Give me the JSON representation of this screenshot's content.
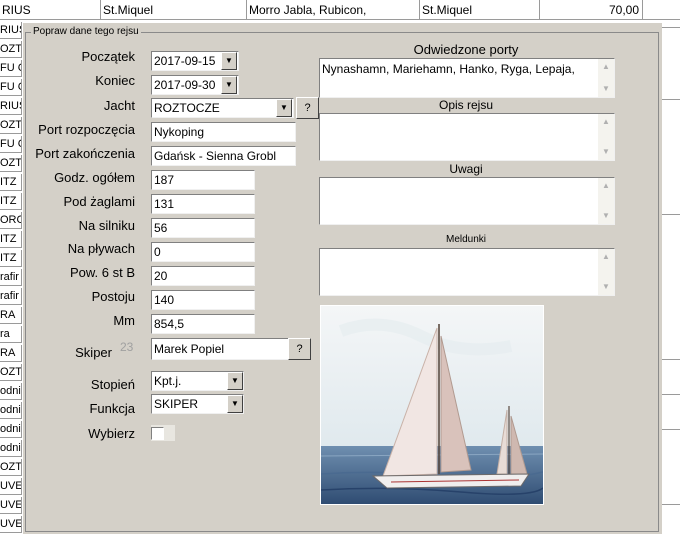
{
  "grid": {
    "top_row": [
      "RIUS",
      "St.Miquel",
      "Morro Jabla, Rubicon,",
      "St.Miquel",
      "70,00"
    ],
    "left_cells": [
      "RIUS",
      "OZTC",
      "FU C",
      "FU C",
      "RIUS",
      "OZTC",
      "FU C",
      "OZTC",
      "ITZ",
      "ITZ",
      "ORC",
      "ITZ",
      "ITZ",
      "rafir",
      "rafir",
      "RA",
      "ra",
      "RA",
      "OZTC",
      "odni",
      "odni",
      "odni",
      "odni",
      "OZTC",
      "UVE",
      "UVE",
      "UVE"
    ]
  },
  "form": {
    "title": "Popraw dane tego rejsu",
    "labels": {
      "start": "Początek",
      "end": "Koniec",
      "yacht": "Jacht",
      "port_start": "Port rozpoczęcia",
      "port_end": "Port zakończenia",
      "hours_total": "Godz. ogółem",
      "under_sail": "Pod żaglami",
      "on_engine": "Na silniku",
      "in_port": "Na pływach",
      "over6b": "Pow. 6 st B",
      "stop": "Postoju",
      "mm": "Mm",
      "skipper": "Skiper",
      "rank": "Stopień",
      "function": "Funkcja",
      "select": "Wybierz"
    },
    "values": {
      "start": "2017-09-15",
      "end": "2017-09-30",
      "yacht": "ROZTOCZE",
      "port_start": "Nykoping",
      "port_end": "Gdańsk - Sienna Grobl",
      "hours_total": "187",
      "under_sail": "131",
      "on_engine": "56",
      "in_port": "0",
      "over6b": "20",
      "stop": "140",
      "mm": "854,5",
      "skipper_id": "23",
      "skipper": "Marek Popiel",
      "rank": "Kpt.j.",
      "function": "SKIPER"
    },
    "q_label": "?",
    "captions": {
      "ports": "Odwiedzone porty",
      "description": "Opis rejsu",
      "notes": "Uwagi",
      "reports": "Meldunki"
    },
    "ports_value": "Nynashamn, Mariehamn, Hanko, Ryga, Lepaja,"
  },
  "photo": {
    "subject": "sailboat-photo"
  },
  "colors": {
    "panel": "#d4d0c8",
    "grid_line": "#9a9a9a"
  }
}
